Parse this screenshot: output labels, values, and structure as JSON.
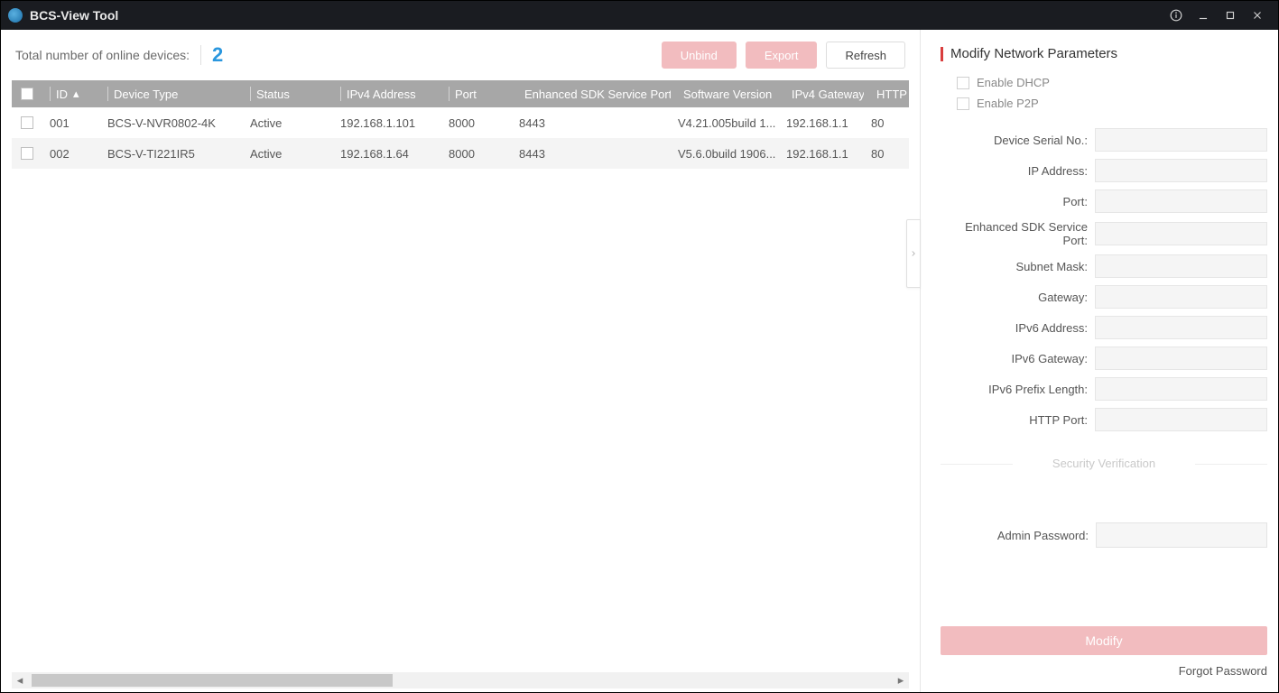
{
  "window": {
    "title": "BCS-View Tool"
  },
  "main": {
    "count_label": "Total number of online devices:",
    "count_value": "2",
    "buttons": {
      "unbind": "Unbind",
      "export": "Export",
      "refresh": "Refresh"
    }
  },
  "table": {
    "headers": {
      "id": "ID",
      "device_type": "Device Type",
      "status": "Status",
      "ipv4": "IPv4 Address",
      "port": "Port",
      "esdk": "Enhanced SDK Service Port",
      "version": "Software Version",
      "gateway": "IPv4 Gateway",
      "http": "HTTP"
    },
    "rows": [
      {
        "id": "001",
        "device_type": "BCS-V-NVR0802-4K",
        "status": "Active",
        "ipv4": "192.168.1.101",
        "port": "8000",
        "esdk": "8443",
        "version": "V4.21.005build 1...",
        "gateway": "192.168.1.1",
        "http": "80"
      },
      {
        "id": "002",
        "device_type": "BCS-V-TI221IR5",
        "status": "Active",
        "ipv4": "192.168.1.64",
        "port": "8000",
        "esdk": "8443",
        "version": "V5.6.0build 1906...",
        "gateway": "192.168.1.1",
        "http": "80"
      }
    ]
  },
  "side": {
    "title": "Modify Network Parameters",
    "dhcp": "Enable DHCP",
    "p2p": "Enable P2P",
    "fields": {
      "serial": "Device Serial No.:",
      "ip": "IP Address:",
      "port": "Port:",
      "esdk": "Enhanced SDK Service Port:",
      "subnet": "Subnet Mask:",
      "gateway": "Gateway:",
      "ipv6a": "IPv6 Address:",
      "ipv6g": "IPv6 Gateway:",
      "ipv6p": "IPv6 Prefix Length:",
      "http": "HTTP Port:"
    },
    "sec_ver": "Security Verification",
    "admin_label": "Admin Password:",
    "modify": "Modify",
    "forgot": "Forgot Password"
  }
}
